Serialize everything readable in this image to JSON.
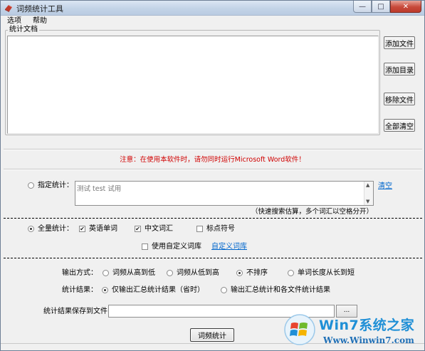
{
  "window": {
    "title": "词频统计工具",
    "min_glyph": "—",
    "max_glyph": "□",
    "close_glyph": "✕"
  },
  "menu": [
    "选项",
    "帮助"
  ],
  "documents": {
    "group_label": "统计文档",
    "buttons": {
      "add_file": "添加文件",
      "add_dir": "添加目录",
      "remove_file": "移除文件",
      "clear_all": "全部清空"
    }
  },
  "notice": "注意：在使用本软件时，请勿同时运行Microsoft Word软件！",
  "specify": {
    "label": "指定统计：",
    "selected": false,
    "text": "测试 test 试用",
    "clear_link": "清空",
    "hint": "（快速搜索估算，多个词汇以空格分开）"
  },
  "full": {
    "label": "全量统计：",
    "selected": true,
    "english": {
      "label": "英语单词",
      "checked": true
    },
    "chinese": {
      "label": "中文词汇",
      "checked": true
    },
    "punct": {
      "label": "标点符号",
      "checked": false
    },
    "custom_dict": {
      "label": "使用自定义词库",
      "checked": false
    },
    "custom_dict_link": "自定义词库"
  },
  "output": {
    "mode_label": "输出方式：",
    "modes": [
      {
        "label": "词频从高到低",
        "selected": false
      },
      {
        "label": "词频从低到高",
        "selected": false
      },
      {
        "label": "不排序",
        "selected": true
      },
      {
        "label": "单词长度从长到短",
        "selected": false
      }
    ],
    "result_label": "统计结果：",
    "results": [
      {
        "label": "仅输出汇总统计结果（省时）",
        "selected": true
      },
      {
        "label": "输出汇总统计和各文件统计结果",
        "selected": false
      }
    ],
    "save_label": "统计结果保存到文件：",
    "save_path": "",
    "browse_label": "..."
  },
  "run_button": "词频统计",
  "watermark": {
    "title": "Win7系统之家",
    "url": "Www.Winwin7.com"
  },
  "colors": {
    "notice": "#d00000",
    "link": "#0066cc",
    "watermark": "#1f8fd6"
  },
  "icons": {
    "app": "app-icon",
    "checkmark": "✔"
  }
}
